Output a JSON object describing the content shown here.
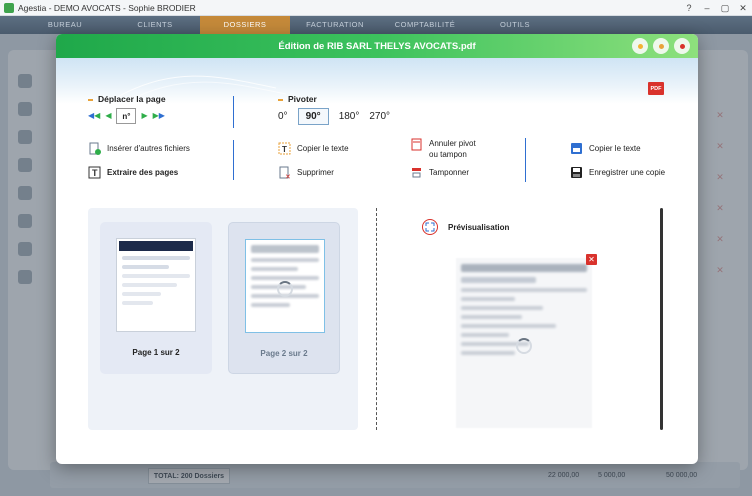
{
  "os_window": {
    "title": "Agestia - DEMO AVOCATS - Sophie BRODIER",
    "controls": [
      "?",
      "–",
      "▢",
      "✕"
    ]
  },
  "app_nav": {
    "tabs": [
      {
        "label": "BUREAU",
        "active": false
      },
      {
        "label": "CLIENTS",
        "active": false
      },
      {
        "label": "DOSSIERS",
        "active": true
      },
      {
        "label": "FACTURATION",
        "active": false
      },
      {
        "label": "COMPTABILITÉ",
        "active": false
      },
      {
        "label": "OUTILS",
        "active": false
      }
    ]
  },
  "background": {
    "total_label": "TOTAL: 200 Dossiers",
    "amounts": [
      "22 000,00",
      "5 000,00",
      "50 000,00"
    ]
  },
  "modal": {
    "title": "Édition de RIB SARL THELYS AVOCATS.pdf",
    "pdf_badge": "PDF",
    "sections": {
      "move_page": {
        "label": "Déplacer la page",
        "input_value": "n°"
      },
      "rotate": {
        "label": "Pivoter",
        "options": [
          "0°",
          "90°",
          "180°",
          "270°"
        ],
        "selected": "90°"
      }
    },
    "tools": {
      "insert_files": "Insérer d'autres fichiers",
      "extract_pages": "Extraire des pages",
      "copy_text_1": "Copier le texte",
      "delete": "Supprimer",
      "cancel_pivot": "Annuler pivot",
      "cancel_pivot_2": "ou tampon",
      "stamp": "Tamponner",
      "copy_text_2": "Copier le texte",
      "save_copy": "Enregistrer une copie"
    },
    "thumbnails": [
      {
        "label": "Page 1 sur 2",
        "selected": true
      },
      {
        "label": "Page 2 sur 2",
        "selected": false
      }
    ],
    "preview": {
      "label": "Prévisualisation"
    },
    "colors": {
      "header_green": "#2db552",
      "accent_orange": "#e8a23a",
      "accent_blue": "#2f6fd1",
      "accent_red": "#d9322c"
    }
  }
}
